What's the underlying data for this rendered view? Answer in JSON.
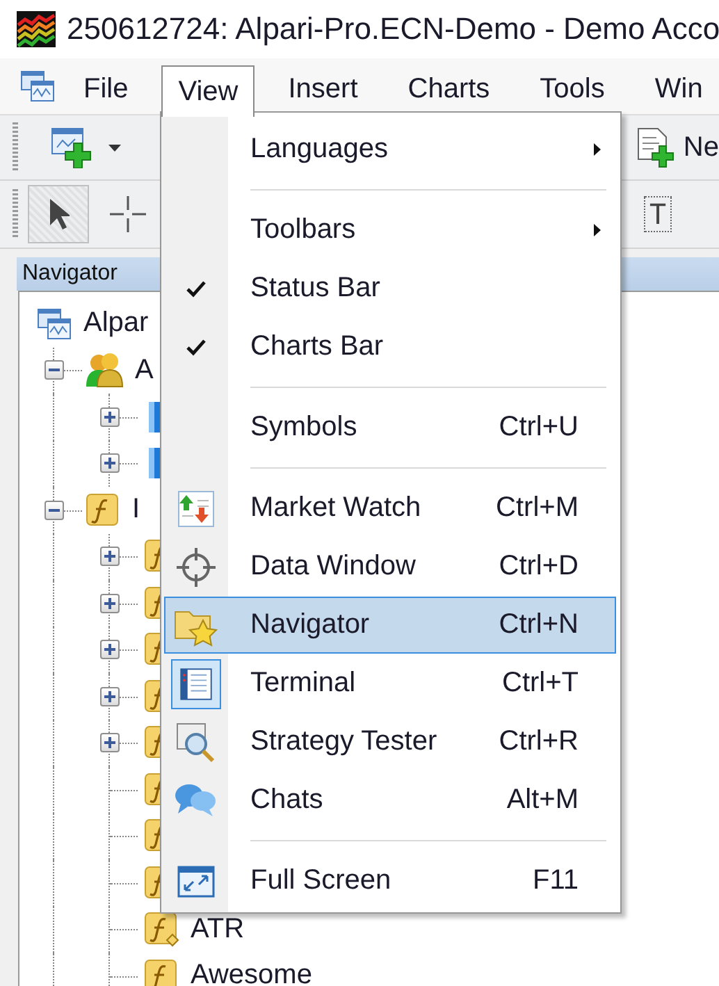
{
  "window": {
    "title": "250612724: Alpari-Pro.ECN-Demo - Demo Acco"
  },
  "menu_bar": [
    {
      "label": "File",
      "selected": false
    },
    {
      "label": "View",
      "selected": true
    },
    {
      "label": "Insert",
      "selected": false
    },
    {
      "label": "Charts",
      "selected": false
    },
    {
      "label": "Tools",
      "selected": false
    },
    {
      "label": "Win",
      "selected": false
    }
  ],
  "toolbar_1": {
    "new_order_button": "Ne"
  },
  "toolbar_2": {
    "tools": [
      {
        "kind": "cursor",
        "selected": true
      },
      {
        "kind": "crosshair",
        "selected": false
      },
      {
        "kind": "text",
        "label": "T",
        "selected": false
      }
    ]
  },
  "navigator": {
    "title": "Navigator",
    "tree": [
      {
        "kind": "root",
        "label": "Alpar",
        "children": [
          {
            "kind": "accounts",
            "label": "A",
            "expanded": true,
            "children": [
              {
                "kind": "account",
                "expanded": false
              },
              {
                "kind": "account",
                "expanded": false
              }
            ]
          },
          {
            "kind": "indicators",
            "label": "I",
            "expanded": true,
            "children": [
              {
                "kind": "indicator",
                "expanded": false
              },
              {
                "kind": "indicator",
                "expanded": false
              },
              {
                "kind": "indicator",
                "expanded": false
              },
              {
                "kind": "indicator",
                "expanded": false
              },
              {
                "kind": "indicator",
                "expanded": false
              },
              {
                "kind": "indicator"
              },
              {
                "kind": "indicator"
              },
              {
                "kind": "indicator"
              },
              {
                "kind": "custom-indicator",
                "label": "ATR"
              },
              {
                "kind": "indicator",
                "label": "Awesome"
              }
            ]
          }
        ]
      }
    ]
  },
  "view_menu": {
    "items": [
      {
        "kind": "item",
        "label": "Languages",
        "submenu": true,
        "checked": false,
        "selected": false
      },
      {
        "kind": "separator"
      },
      {
        "kind": "item",
        "label": "Toolbars",
        "submenu": true,
        "checked": false,
        "selected": false
      },
      {
        "kind": "item",
        "label": "Status Bar",
        "submenu": false,
        "checked": true,
        "selected": false
      },
      {
        "kind": "item",
        "label": "Charts Bar",
        "submenu": false,
        "checked": true,
        "selected": false
      },
      {
        "kind": "separator"
      },
      {
        "kind": "item",
        "label": "Symbols",
        "shortcut": "Ctrl+U",
        "submenu": false,
        "checked": false,
        "selected": false
      },
      {
        "kind": "separator"
      },
      {
        "kind": "item",
        "label": "Market Watch",
        "shortcut": "Ctrl+M",
        "submenu": false,
        "checked": false,
        "selected": false
      },
      {
        "kind": "item",
        "label": "Data Window",
        "shortcut": "Ctrl+D",
        "submenu": false,
        "checked": false,
        "selected": false
      },
      {
        "kind": "item",
        "label": "Navigator",
        "shortcut": "Ctrl+N",
        "submenu": false,
        "checked": false,
        "selected": true
      },
      {
        "kind": "item",
        "label": "Terminal",
        "shortcut": "Ctrl+T",
        "submenu": false,
        "checked": true,
        "selected": false
      },
      {
        "kind": "item",
        "label": "Strategy Tester",
        "shortcut": "Ctrl+R",
        "submenu": false,
        "checked": false,
        "selected": false
      },
      {
        "kind": "item",
        "label": "Chats",
        "shortcut": "Alt+M",
        "submenu": false,
        "checked": false,
        "selected": false
      },
      {
        "kind": "separator"
      },
      {
        "kind": "item",
        "label": "Full Screen",
        "shortcut": "F11",
        "submenu": false,
        "checked": false,
        "selected": false
      }
    ]
  }
}
